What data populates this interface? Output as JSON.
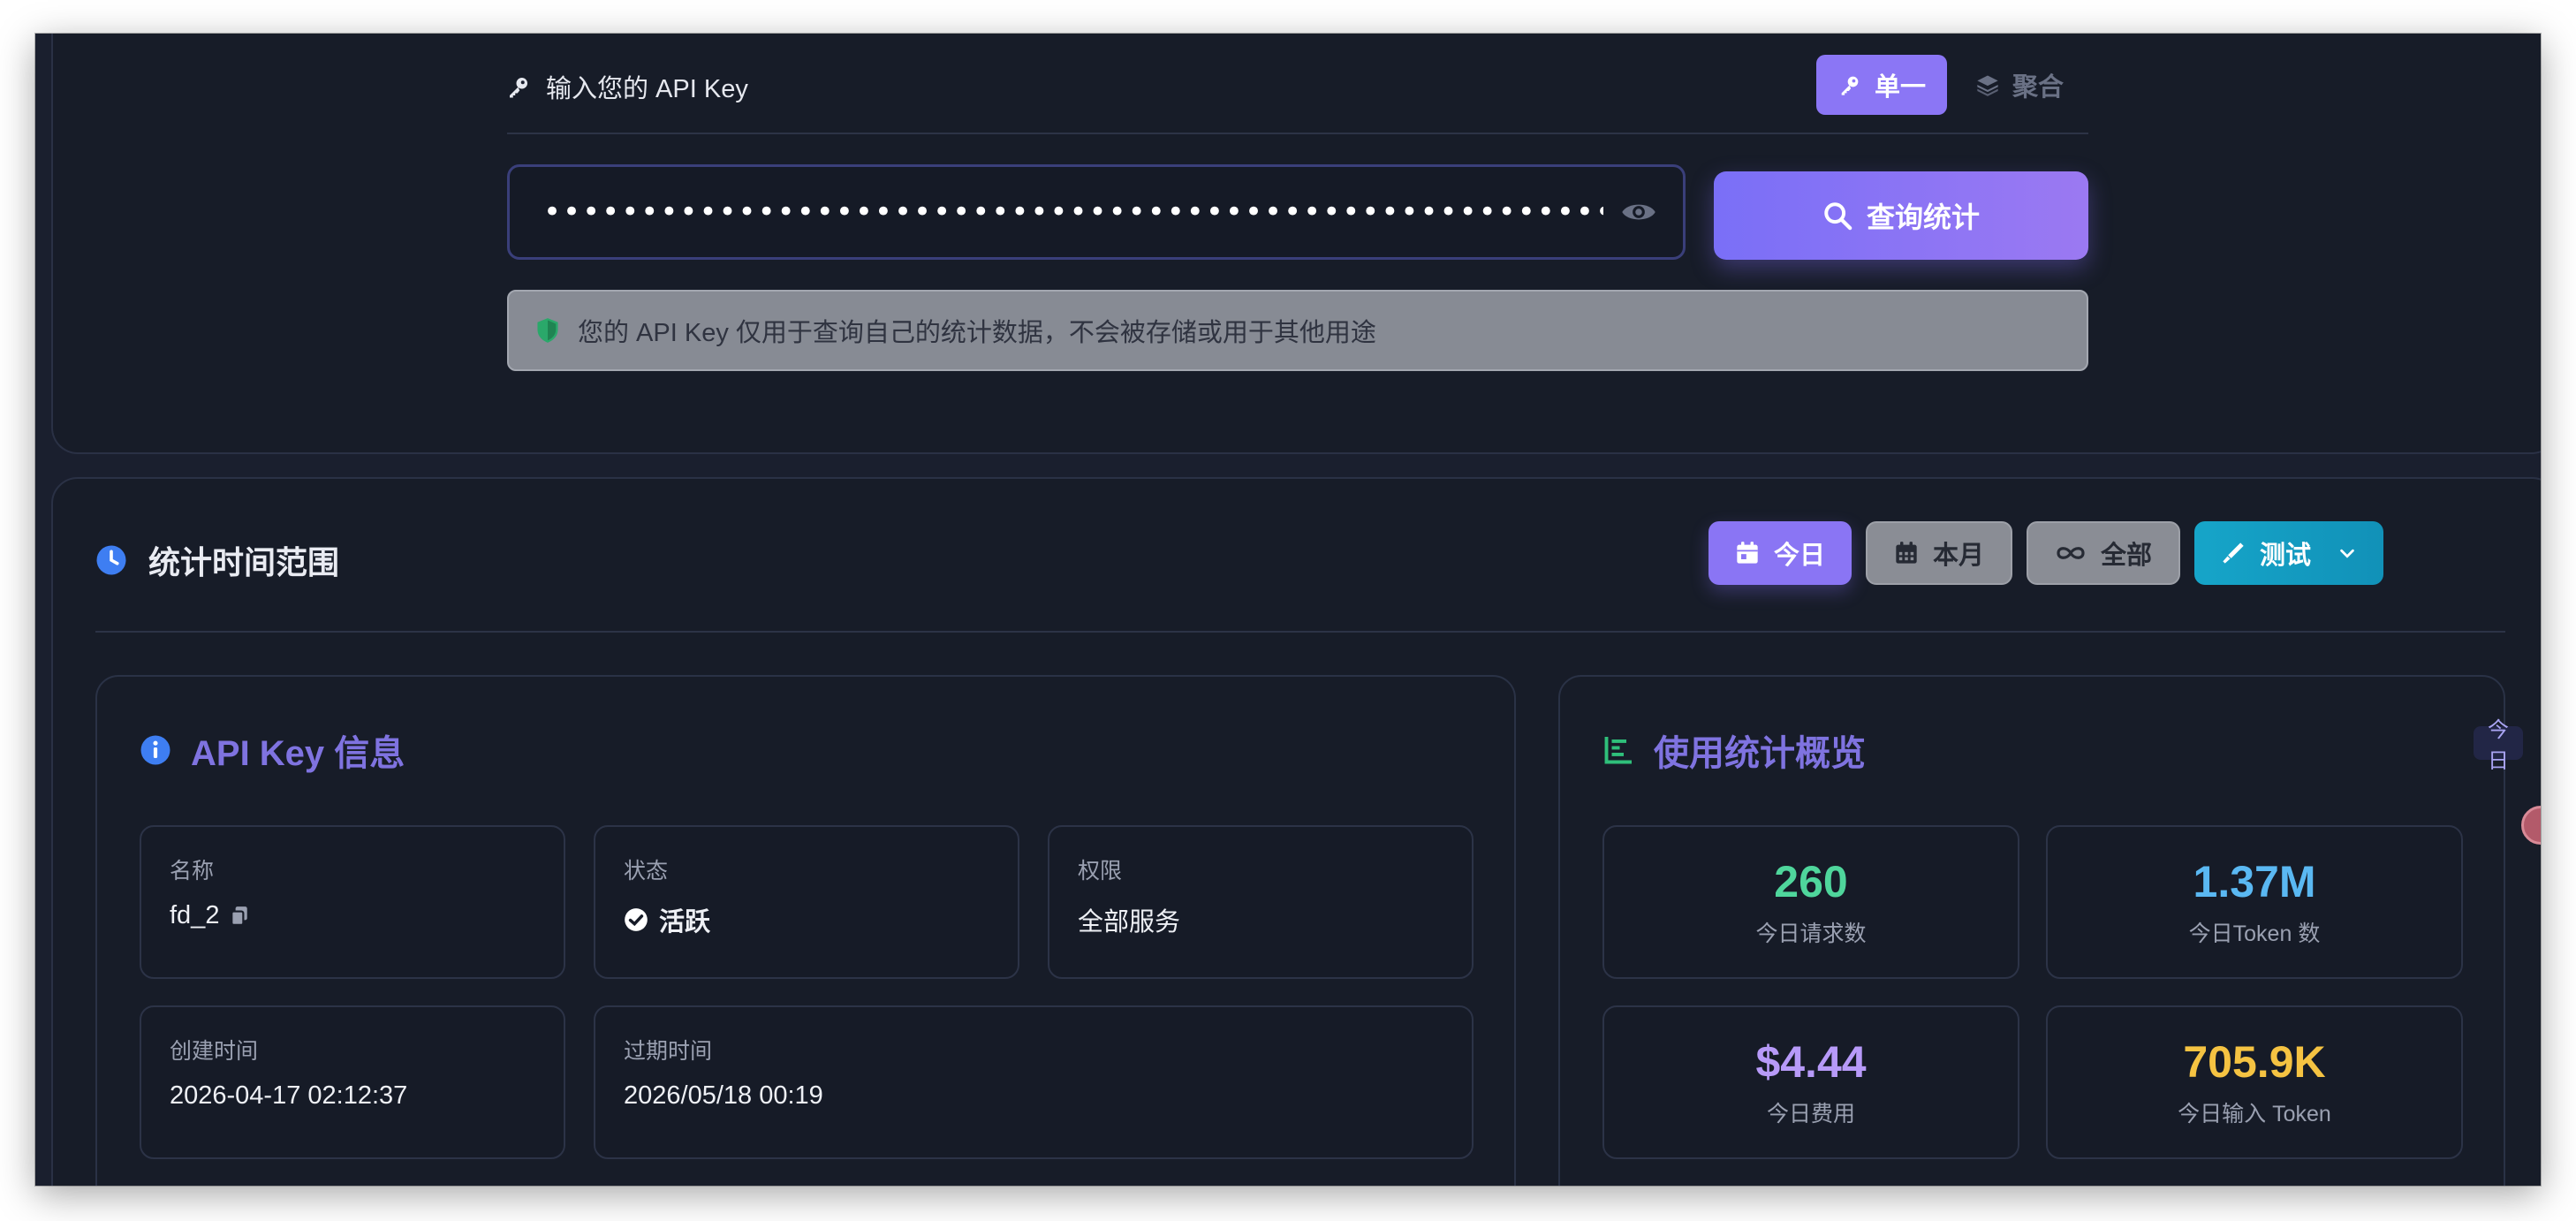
{
  "key_section": {
    "label": "输入您的 API Key",
    "modes": [
      {
        "label": "单一",
        "icon": "key-icon",
        "active": true
      },
      {
        "label": "聚合",
        "icon": "layers-icon",
        "active": false
      }
    ],
    "input_value": "••••••••••••••••••••••••••••••••••••••••••••••••••••••••••••••••",
    "query_button": "查询统计",
    "notice": "您的 API Key 仅用于查询自己的统计数据，不会被存储或用于其他用途"
  },
  "range_section": {
    "title": "统计时间范围",
    "buttons": [
      {
        "label": "今日",
        "icon": "calendar-day-icon"
      },
      {
        "label": "本月",
        "icon": "calendar-icon"
      },
      {
        "label": "全部",
        "icon": "infinity-icon"
      },
      {
        "label": "测试",
        "icon": "flask-icon"
      }
    ]
  },
  "api_info": {
    "title": "API Key 信息",
    "name_label": "名称",
    "name_value": "fd_2",
    "status_label": "状态",
    "status_value": "活跃",
    "permission_label": "权限",
    "permission_value": "全部服务",
    "created_label": "创建时间",
    "created_value": "2026-04-17 02:12:37",
    "expires_label": "过期时间",
    "expires_value": "2026/05/18 00:19"
  },
  "usage": {
    "title": "使用统计概览",
    "badge": "今日",
    "requests_value": "260",
    "requests_label": "今日请求数",
    "tokens_value": "1.37M",
    "tokens_label": "今日Token 数",
    "cost_value": "$4.44",
    "cost_label": "今日费用",
    "input_tokens_value": "705.9K",
    "input_tokens_label": "今日输入 Token"
  },
  "colors": {
    "accent": "#8b76f5",
    "requests": "#4fd69c",
    "tokens": "#5ab8f2",
    "cost": "#b79af8",
    "input_tokens": "#f5c342",
    "status_ok": "#ffffff",
    "test_button": "#1497bf"
  }
}
